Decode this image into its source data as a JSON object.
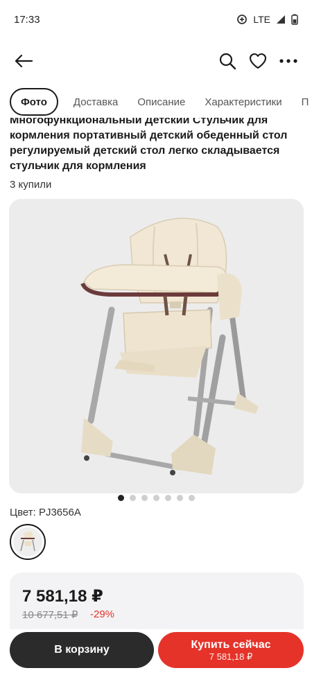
{
  "status_bar": {
    "time": "17:33",
    "network": "LTE"
  },
  "top_nav": {
    "back_icon": "arrow-left-icon",
    "search_icon": "search-icon",
    "favorite_icon": "heart-icon",
    "more_icon": "more-horizontal-icon"
  },
  "tabs": [
    {
      "label": "Фото",
      "active": true
    },
    {
      "label": "Доставка",
      "active": false
    },
    {
      "label": "Описание",
      "active": false
    },
    {
      "label": "Характеристики",
      "active": false
    },
    {
      "label": "П",
      "active": false
    }
  ],
  "product": {
    "title": "Многофункциональный Детский Стульчик для кормления портативный детский обеденный стол регулируемый детский стол легко складывается стульчик для кормления",
    "purchases": "3 купили",
    "color_label": "Цвет: PJ3656A",
    "image_count": 7,
    "active_image": 0
  },
  "price": {
    "current": "7 581,18 ₽",
    "old": "10 677,51 ₽",
    "discount": "-29%"
  },
  "actions": {
    "cart_label": "В корзину",
    "buy_label": "Купить сейчас",
    "buy_price": "7 581,18 ₽"
  },
  "colors": {
    "accent": "#e5332a",
    "dark": "#2b2b2b",
    "card_bg": "#f3f3f5"
  }
}
